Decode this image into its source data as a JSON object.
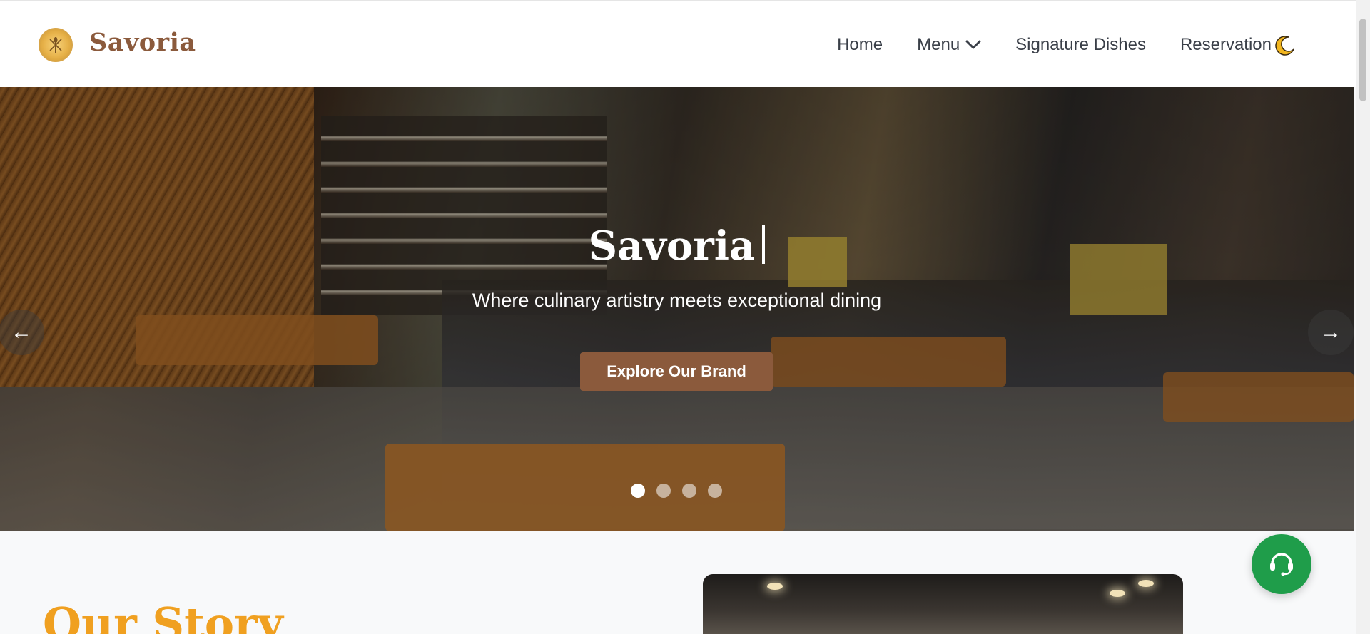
{
  "header": {
    "brand": "Savoria",
    "nav": [
      {
        "label": "Home"
      },
      {
        "label": "Menu"
      },
      {
        "label": "Signature Dishes"
      },
      {
        "label": "Reservation"
      }
    ]
  },
  "hero": {
    "title": "Savoria",
    "subtitle": "Where culinary artistry meets exceptional dining",
    "cta_label": "Explore Our Brand",
    "prev_glyph": "←",
    "next_glyph": "→",
    "slides_count": 4,
    "active_slide": 1
  },
  "story": {
    "title": "Our Story"
  },
  "colors": {
    "brand": "#8b5a3c",
    "accent_gold": "#f0a020",
    "support_green": "#1f9d4a"
  },
  "icons": {
    "logo": "wheat-logo-icon",
    "theme": "moon-icon",
    "menu_dropdown": "chevron-down-icon",
    "support": "headset-icon"
  }
}
